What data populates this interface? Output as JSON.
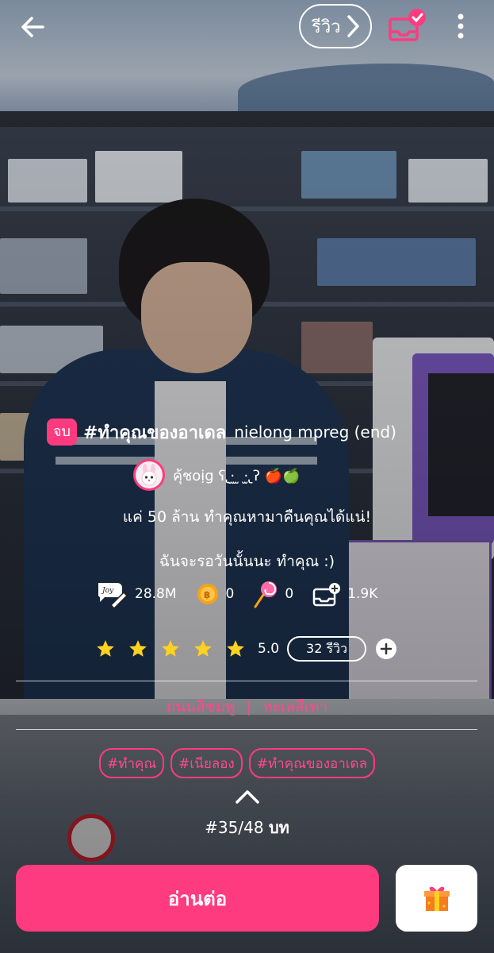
{
  "header": {
    "review_label": "รีวิว",
    "icons": [
      "arrow-left-icon",
      "chevron-right-icon",
      "library-check-icon",
      "more-vert-icon"
    ]
  },
  "story": {
    "status_badge": "จบ",
    "title": "#ทำคุณของอาเดล",
    "title_sub": "nielong mpreg (end)",
    "author": "คุ้ชoịg ʕ ̢·̫ ̫ ·̫ ̢ʔ 🍎🍏",
    "tagline1": "แค่ 50 ล้าน ทำคุณหามาคืนคุณได้แน่!",
    "tagline2": "ฉันจะรอวันนั้นนะ ทำคุณ :)"
  },
  "stats": {
    "views": "28.8M",
    "coins": "0",
    "candy": "0",
    "library_adds": "1.9K"
  },
  "rating": {
    "stars": 5,
    "value": "5.0",
    "review_count_label": "32 รีวิว"
  },
  "category": {
    "primary": "ถนนสีชมพู",
    "separator": "|",
    "secondary": "ทะเลสีเทา"
  },
  "tags": [
    "#ทำคุณ",
    "#เนียลอง",
    "#ทำคุณของอาเดล"
  ],
  "chapter": {
    "current": "#35/48",
    "unit": "บท"
  },
  "footer": {
    "read_label": "อ่านต่อ"
  },
  "colors": {
    "accent": "#ff3b7f",
    "star": "#ffd21f"
  }
}
